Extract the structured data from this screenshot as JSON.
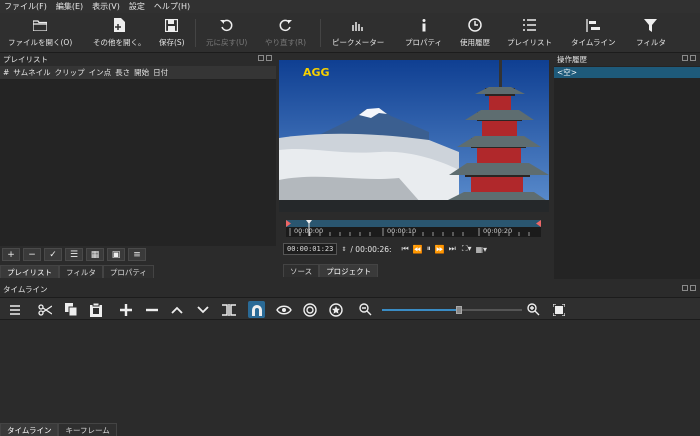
{
  "menu": [
    "ファイル(F)",
    "編集(E)",
    "表示(V)",
    "設定",
    "ヘルプ(H)"
  ],
  "toolbar": {
    "open_file": "ファイルを開く(O)",
    "open_other": "その他を開く。",
    "save": "保存(S)",
    "undo": "元に戻す(U)",
    "redo": "やり直す(R)",
    "peak_meter": "ピークメーター",
    "properties": "プロパティ",
    "history": "使用履歴",
    "playlist": "プレイリスト",
    "timeline": "タイムライン",
    "filters": "フィルタ"
  },
  "playlist": {
    "title": "プレイリスト",
    "columns": [
      "#",
      "サムネイル",
      "クリップ",
      "イン点",
      "長さ",
      "開始",
      "日付"
    ],
    "tabs": [
      "プレイリスト",
      "フィルタ",
      "プロパティ"
    ]
  },
  "player": {
    "logo": "AGG",
    "ruler": [
      "00:00:00",
      "00:00:10",
      "00:00:20"
    ],
    "timecode": "00:00:01:23",
    "duration": "/ 00:00:26:",
    "tabs": [
      "ソース",
      "プロジェクト"
    ]
  },
  "history": {
    "title": "操作履歴",
    "empty": "<空>"
  },
  "timeline": {
    "title": "タイムライン",
    "zoom_level": 0.55
  },
  "bottom_tabs": [
    "タイムライン",
    "キーフレーム"
  ]
}
